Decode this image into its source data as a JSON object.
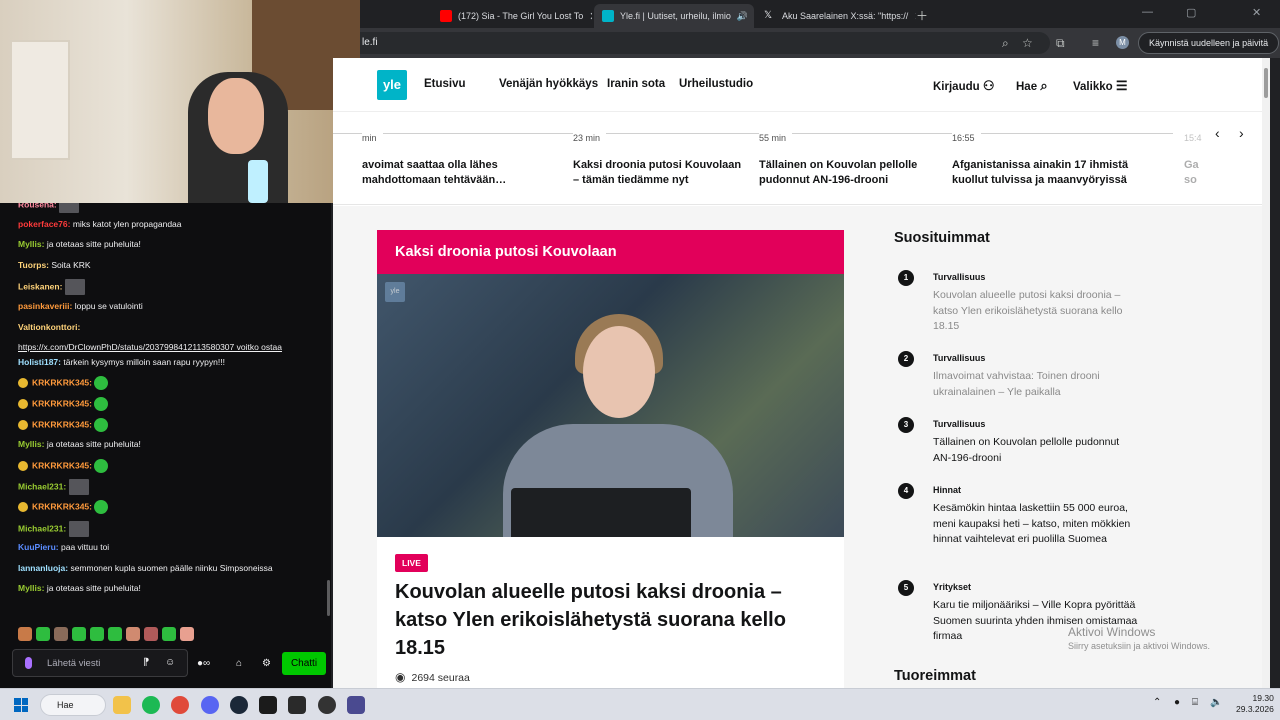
{
  "browser": {
    "tabs": [
      {
        "label": "(172) Sia - The Girl You Lost To",
        "icon": "youtube-icon",
        "icon_color": "#ff0000",
        "audible": false
      },
      {
        "label": "Yle.fi | Uutiset, urheilu, ilmio",
        "icon": "yle-icon",
        "icon_color": "#00b4c8",
        "audible": true
      },
      {
        "label": "Aku Saarelainen X:ssä: \"https://",
        "icon": "x-icon",
        "icon_color": "#000000",
        "audible": false
      }
    ],
    "address": "le.fi",
    "relaunch_label": "Käynnistä uudelleen ja päivitä",
    "profile_initial": "M"
  },
  "yle": {
    "logo": "yle",
    "nav": [
      "Etusivu",
      "Venäjän hyökkäys",
      "Iranin sota",
      "Urheilustudio"
    ],
    "login": "Kirjaudu",
    "search": "Hae",
    "menu": "Valikko",
    "ticker": [
      {
        "time": "min",
        "title": "avoimat saattaa olla lähes mahdottomaan tehtävään…"
      },
      {
        "time": "23 min",
        "title": "Kaksi droonia putosi Kouvolaan – tämän tiedämme nyt"
      },
      {
        "time": "55 min",
        "title": "Tällainen on Kouvolan pellolle pudonnut AN-196-drooni"
      },
      {
        "time": "16:55",
        "title": "Afganistanissa ainakin 17 ihmistä kuollut tulvissa ja maanvyöryissä"
      },
      {
        "time": "15:4",
        "title": "Ga so"
      }
    ],
    "card": {
      "banner": "Kaksi droonia putosi Kouvolaan",
      "video_logo": "yle",
      "live": "LIVE",
      "headline": "Kouvolan alueelle putosi kaksi droonia – katso Ylen erikoislähetystä suorana kello 18.15",
      "followers": "2694 seuraa"
    },
    "popular": {
      "title": "Suosituimmat",
      "items": [
        {
          "num": "1",
          "category": "Turvallisuus",
          "title": "Kouvolan alueelle putosi kaksi droonia – katso Ylen erikoislähetystä suorana kello 18.15",
          "read": true
        },
        {
          "num": "2",
          "category": "Turvallisuus",
          "title": "Ilmavoimat vahvistaa: Toinen drooni ukrainalainen – Yle paikalla",
          "read": true
        },
        {
          "num": "3",
          "category": "Turvallisuus",
          "title": "Tällainen on Kouvolan pellolle pudonnut AN-196-drooni",
          "read": false
        },
        {
          "num": "4",
          "category": "Hinnat",
          "title": "Kesämökin hintaa laskettiin 55 000 euroa, meni kaupaksi heti – katso, miten mökkien hinnat vaihtelevat eri puolilla Suomea",
          "read": false
        },
        {
          "num": "5",
          "category": "Yritykset",
          "title": "Karu tie miljonääriksi – Ville Kopra pyörittää Suomen suurinta yhden ihmisen omistamaa firmaa",
          "read": false
        }
      ]
    },
    "latest_title": "Tuoreimmat",
    "watermark": {
      "title": "Aktivoi Windows",
      "subtitle": "Siirry asetuksiin ja aktivoi Windows."
    }
  },
  "chat": {
    "messages": [
      {
        "user": "Rousena:",
        "color": "#ff8aa0",
        "text": "",
        "emote": "pic",
        "badge": false
      },
      {
        "user": "pokerface76:",
        "color": "#ff3b3b",
        "text": "miks katot ylen propagandaa",
        "emote": "",
        "badge": false
      },
      {
        "user": "Myllis:",
        "color": "#9acd32",
        "text": "ja otetaas sitte puheluita!",
        "emote": "",
        "badge": false
      },
      {
        "user": "Tuorps:",
        "color": "#ffd37a",
        "text": "Soita KRK",
        "emote": "",
        "badge": false
      },
      {
        "user": "Leiskanen:",
        "color": "#ffd37a",
        "text": "",
        "emote": "pic",
        "badge": false
      },
      {
        "user": "pasinkaveriii:",
        "color": "#ff9a3c",
        "text": "loppu se vatulointi",
        "emote": "",
        "badge": false
      },
      {
        "user": "Valtionkonttori:",
        "color": "#ffd37a",
        "text": "",
        "emote": "",
        "badge": false
      },
      {
        "user": "",
        "color": "#efeff1",
        "text": "https://x.com/DrClownPhD/status/2037998412113580307 voitko ostaa",
        "emote": "",
        "badge": false
      },
      {
        "user": "Holisti187:",
        "color": "#9fe0ff",
        "text": "tärkein kysymys milloin saan rapu ryypyn!!!",
        "emote": "",
        "badge": false
      },
      {
        "user": "KRKRKRK345:",
        "color": "#ff9a3c",
        "text": "",
        "emote": "green",
        "badge": true
      },
      {
        "user": "KRKRKRK345:",
        "color": "#ff9a3c",
        "text": "",
        "emote": "green",
        "badge": true
      },
      {
        "user": "KRKRKRK345:",
        "color": "#ff9a3c",
        "text": "",
        "emote": "green",
        "badge": true
      },
      {
        "user": "Myllis:",
        "color": "#9acd32",
        "text": "ja otetaas sitte puheluita!",
        "emote": "",
        "badge": false
      },
      {
        "user": "KRKRKRK345:",
        "color": "#ff9a3c",
        "text": "",
        "emote": "green",
        "badge": true
      },
      {
        "user": "Michael231:",
        "color": "#9acd32",
        "text": "",
        "emote": "pic",
        "badge": false
      },
      {
        "user": "KRKRKRK345:",
        "color": "#ff9a3c",
        "text": "",
        "emote": "green",
        "badge": true
      },
      {
        "user": "Michael231:",
        "color": "#9acd32",
        "text": "",
        "emote": "pic",
        "badge": false
      },
      {
        "user": "KuuPieru:",
        "color": "#5a8cff",
        "text": "paa vittuu toi",
        "emote": "",
        "badge": false
      },
      {
        "user": "lannanluoja:",
        "color": "#9fe0ff",
        "text": "semmonen kupla suomen päälle niinku Simpsoneissa",
        "emote": "",
        "badge": false
      },
      {
        "user": "Myllis:",
        "color": "#9acd32",
        "text": "ja otetaas sitte puheluita!",
        "emote": "",
        "badge": false
      }
    ],
    "input_placeholder": "Lähetä viesti",
    "send_label": "Chatti"
  },
  "taskbar": {
    "search": "Hae",
    "time": "19.30",
    "date": "29.3.2026"
  }
}
